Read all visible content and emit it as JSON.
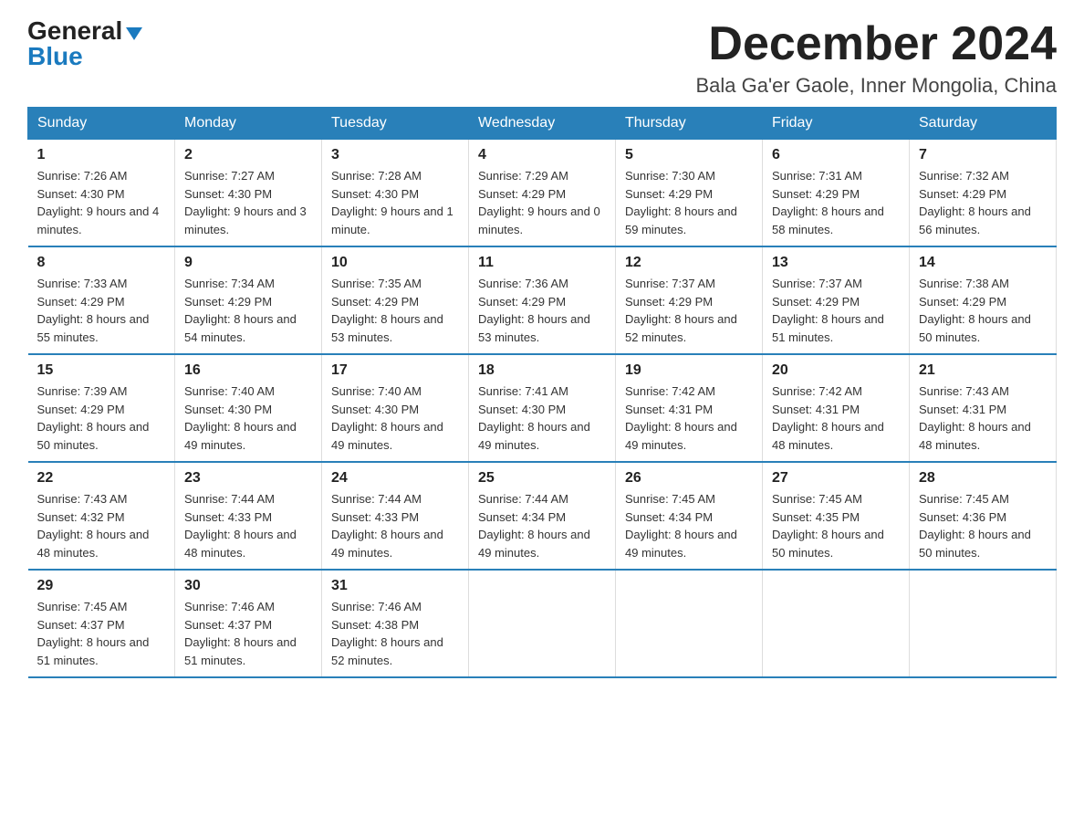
{
  "header": {
    "logo_general": "General",
    "logo_blue": "Blue",
    "month_title": "December 2024",
    "location": "Bala Ga'er Gaole, Inner Mongolia, China"
  },
  "days_of_week": [
    "Sunday",
    "Monday",
    "Tuesday",
    "Wednesday",
    "Thursday",
    "Friday",
    "Saturday"
  ],
  "weeks": [
    [
      {
        "day": "1",
        "sunrise": "7:26 AM",
        "sunset": "4:30 PM",
        "daylight": "9 hours and 4 minutes."
      },
      {
        "day": "2",
        "sunrise": "7:27 AM",
        "sunset": "4:30 PM",
        "daylight": "9 hours and 3 minutes."
      },
      {
        "day": "3",
        "sunrise": "7:28 AM",
        "sunset": "4:30 PM",
        "daylight": "9 hours and 1 minute."
      },
      {
        "day": "4",
        "sunrise": "7:29 AM",
        "sunset": "4:29 PM",
        "daylight": "9 hours and 0 minutes."
      },
      {
        "day": "5",
        "sunrise": "7:30 AM",
        "sunset": "4:29 PM",
        "daylight": "8 hours and 59 minutes."
      },
      {
        "day": "6",
        "sunrise": "7:31 AM",
        "sunset": "4:29 PM",
        "daylight": "8 hours and 58 minutes."
      },
      {
        "day": "7",
        "sunrise": "7:32 AM",
        "sunset": "4:29 PM",
        "daylight": "8 hours and 56 minutes."
      }
    ],
    [
      {
        "day": "8",
        "sunrise": "7:33 AM",
        "sunset": "4:29 PM",
        "daylight": "8 hours and 55 minutes."
      },
      {
        "day": "9",
        "sunrise": "7:34 AM",
        "sunset": "4:29 PM",
        "daylight": "8 hours and 54 minutes."
      },
      {
        "day": "10",
        "sunrise": "7:35 AM",
        "sunset": "4:29 PM",
        "daylight": "8 hours and 53 minutes."
      },
      {
        "day": "11",
        "sunrise": "7:36 AM",
        "sunset": "4:29 PM",
        "daylight": "8 hours and 53 minutes."
      },
      {
        "day": "12",
        "sunrise": "7:37 AM",
        "sunset": "4:29 PM",
        "daylight": "8 hours and 52 minutes."
      },
      {
        "day": "13",
        "sunrise": "7:37 AM",
        "sunset": "4:29 PM",
        "daylight": "8 hours and 51 minutes."
      },
      {
        "day": "14",
        "sunrise": "7:38 AM",
        "sunset": "4:29 PM",
        "daylight": "8 hours and 50 minutes."
      }
    ],
    [
      {
        "day": "15",
        "sunrise": "7:39 AM",
        "sunset": "4:29 PM",
        "daylight": "8 hours and 50 minutes."
      },
      {
        "day": "16",
        "sunrise": "7:40 AM",
        "sunset": "4:30 PM",
        "daylight": "8 hours and 49 minutes."
      },
      {
        "day": "17",
        "sunrise": "7:40 AM",
        "sunset": "4:30 PM",
        "daylight": "8 hours and 49 minutes."
      },
      {
        "day": "18",
        "sunrise": "7:41 AM",
        "sunset": "4:30 PM",
        "daylight": "8 hours and 49 minutes."
      },
      {
        "day": "19",
        "sunrise": "7:42 AM",
        "sunset": "4:31 PM",
        "daylight": "8 hours and 49 minutes."
      },
      {
        "day": "20",
        "sunrise": "7:42 AM",
        "sunset": "4:31 PM",
        "daylight": "8 hours and 48 minutes."
      },
      {
        "day": "21",
        "sunrise": "7:43 AM",
        "sunset": "4:31 PM",
        "daylight": "8 hours and 48 minutes."
      }
    ],
    [
      {
        "day": "22",
        "sunrise": "7:43 AM",
        "sunset": "4:32 PM",
        "daylight": "8 hours and 48 minutes."
      },
      {
        "day": "23",
        "sunrise": "7:44 AM",
        "sunset": "4:33 PM",
        "daylight": "8 hours and 48 minutes."
      },
      {
        "day": "24",
        "sunrise": "7:44 AM",
        "sunset": "4:33 PM",
        "daylight": "8 hours and 49 minutes."
      },
      {
        "day": "25",
        "sunrise": "7:44 AM",
        "sunset": "4:34 PM",
        "daylight": "8 hours and 49 minutes."
      },
      {
        "day": "26",
        "sunrise": "7:45 AM",
        "sunset": "4:34 PM",
        "daylight": "8 hours and 49 minutes."
      },
      {
        "day": "27",
        "sunrise": "7:45 AM",
        "sunset": "4:35 PM",
        "daylight": "8 hours and 50 minutes."
      },
      {
        "day": "28",
        "sunrise": "7:45 AM",
        "sunset": "4:36 PM",
        "daylight": "8 hours and 50 minutes."
      }
    ],
    [
      {
        "day": "29",
        "sunrise": "7:45 AM",
        "sunset": "4:37 PM",
        "daylight": "8 hours and 51 minutes."
      },
      {
        "day": "30",
        "sunrise": "7:46 AM",
        "sunset": "4:37 PM",
        "daylight": "8 hours and 51 minutes."
      },
      {
        "day": "31",
        "sunrise": "7:46 AM",
        "sunset": "4:38 PM",
        "daylight": "8 hours and 52 minutes."
      },
      null,
      null,
      null,
      null
    ]
  ]
}
